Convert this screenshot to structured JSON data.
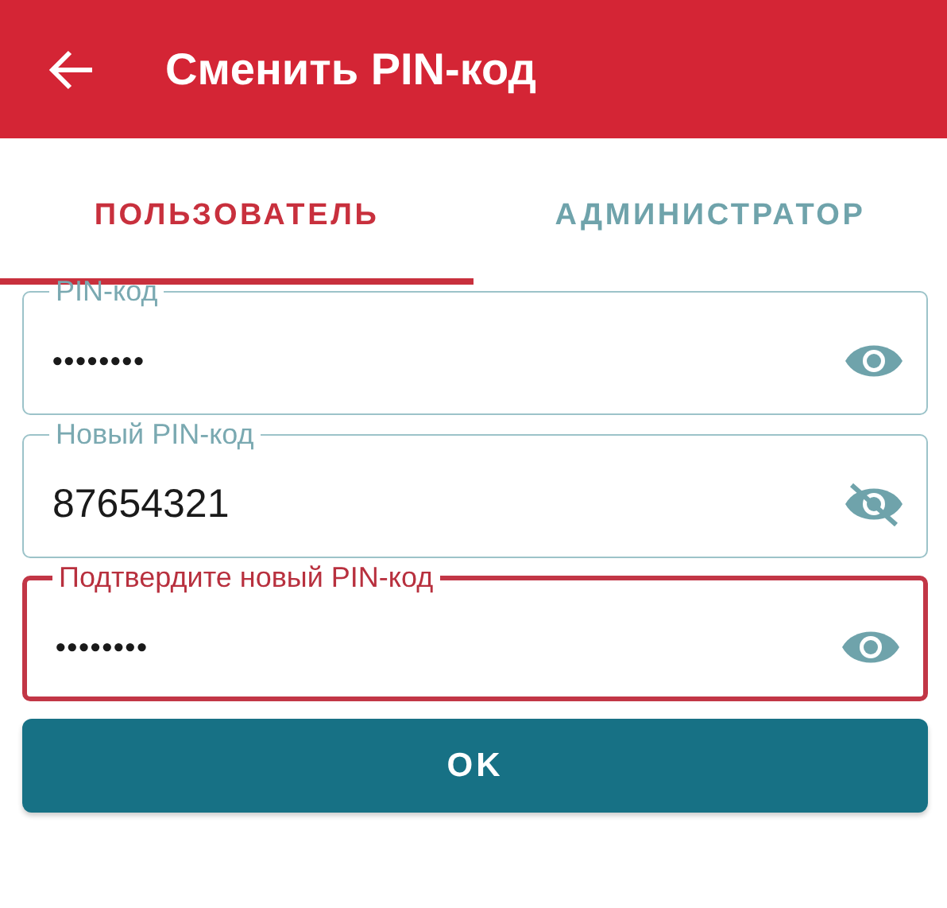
{
  "app_bar": {
    "title": "Сменить PIN-код"
  },
  "tabs": [
    {
      "label": "ПОЛЬЗОВАТЕЛЬ",
      "selected": true
    },
    {
      "label": "АДМИНИСТРАТОР",
      "selected": false
    }
  ],
  "fields": [
    {
      "label": "PIN-код",
      "value": "••••••••",
      "revealed": false,
      "error": false
    },
    {
      "label": "Новый PIN-код",
      "value": "87654321",
      "revealed": true,
      "error": false
    },
    {
      "label": "Подтвердите новый PIN-код",
      "value": "••••••••",
      "revealed": false,
      "error": true
    }
  ],
  "button": "OK"
}
